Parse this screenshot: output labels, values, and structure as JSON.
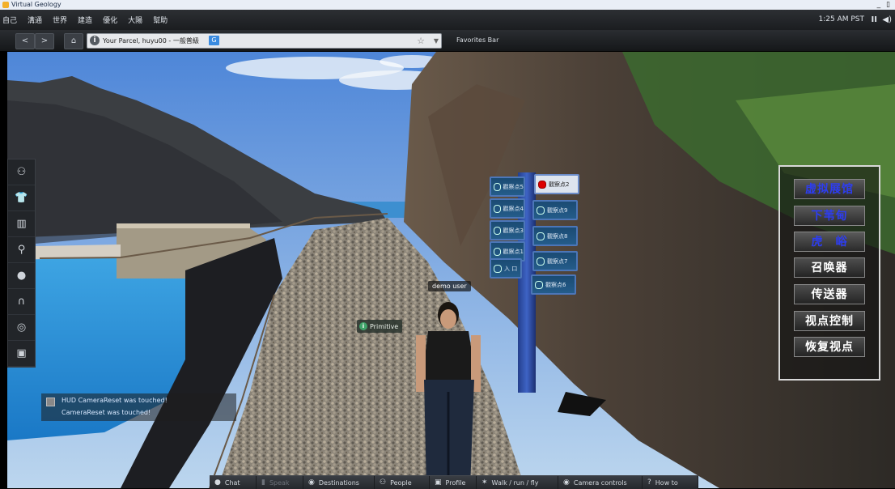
{
  "window": {
    "title": "Virtual Geology",
    "controls": "_ ▯"
  },
  "menu": {
    "items": [
      "自己",
      "溝通",
      "世界",
      "建造",
      "優化",
      "大陽",
      "幫助"
    ],
    "clock": "1:25 AM PST",
    "pause_glyph": "II",
    "volume_glyph": "◀)"
  },
  "nav": {
    "back": "<",
    "forward": ">",
    "home": "⌂",
    "parcel": "Your Parcel, huyu00 - 一般普級",
    "g_badge": "G",
    "favorites": "Favorites Bar"
  },
  "sidebar": {
    "items": [
      "people-icon",
      "shirt-icon",
      "inventory-icon",
      "search-icon",
      "avatar-icon",
      "headphones-icon",
      "voice-icon",
      "snapshot-icon"
    ]
  },
  "sign": {
    "left": [
      "觀察点5",
      "觀察点4",
      "觀察点3",
      "觀察点1",
      "入 口"
    ],
    "right": [
      "觀察点2",
      "觀察点9",
      "觀察点8",
      "觀察点7",
      "觀察点6"
    ]
  },
  "nametag": "demo user",
  "primitive": "Primitive",
  "hud": {
    "buttons": [
      {
        "label": "虚拟展馆",
        "style": "blue"
      },
      {
        "label": "下苇甸",
        "style": "blue"
      },
      {
        "label": "虎　峪",
        "style": "blue"
      },
      {
        "label": "召唤器",
        "style": "white"
      },
      {
        "label": "传送器",
        "style": "white"
      },
      {
        "label": "视点控制",
        "style": "white"
      },
      {
        "label": "恢复视点",
        "style": "white"
      }
    ]
  },
  "chat": {
    "line1": "HUD CameraReset was touched!",
    "line2": "CameraReset was touched!"
  },
  "bottom": {
    "chat": "Chat",
    "speak": "Speak",
    "destinations": "Destinations",
    "people": "People",
    "profile": "Profile",
    "walk": "Walk / run / fly",
    "camera": "Camera controls",
    "howto": "How to"
  }
}
